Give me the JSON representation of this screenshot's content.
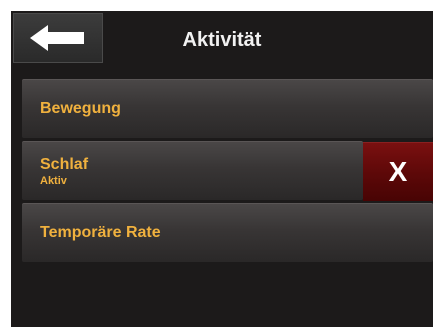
{
  "header": {
    "title": "Aktivität",
    "back_icon": "arrow-left-icon"
  },
  "menu": {
    "items": [
      {
        "label": "Bewegung",
        "sublabel": ""
      },
      {
        "label": "Schlaf",
        "sublabel": "Aktiv",
        "action_label": "X",
        "action_color": "#5c0808"
      },
      {
        "label": "Temporäre Rate",
        "sublabel": ""
      }
    ]
  },
  "colors": {
    "accent": "#f0b13e",
    "background": "#1c1a1a",
    "title": "#f2f2f2"
  }
}
